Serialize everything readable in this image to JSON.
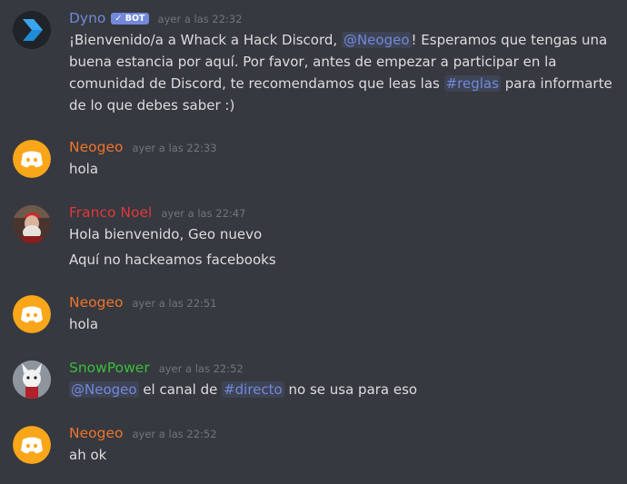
{
  "messages": [
    {
      "author": "Dyno",
      "author_color": "#7289da",
      "bot_tag": "BOT",
      "timestamp": "ayer a las 22:32",
      "avatar": "dyno-avatar",
      "segments": [
        {
          "type": "text",
          "text": "¡Bienvenido/a a Whack a Hack Discord, "
        },
        {
          "type": "mention",
          "text": "@Neogeo"
        },
        {
          "type": "text",
          "text": "! Esperamos que tengas una buena estancia por aquí. Por favor, antes de empezar a participar en la comunidad de Discord, te recomendamos que leas las "
        },
        {
          "type": "mention",
          "text": "#reglas"
        },
        {
          "type": "text",
          "text": " para informarte de lo que debes saber :)"
        }
      ]
    },
    {
      "author": "Neogeo",
      "author_color": "#f0742a",
      "timestamp": "ayer a las 22:33",
      "avatar": "discord-default-avatar",
      "lines": [
        "hola"
      ]
    },
    {
      "author": "Franco Noel",
      "author_color": "#e0383c",
      "timestamp": "ayer a las 22:47",
      "avatar": "user-photo-avatar",
      "lines": [
        "Hola bienvenido, Geo nuevo",
        "Aquí no hackeamos facebooks"
      ]
    },
    {
      "author": "Neogeo",
      "author_color": "#f0742a",
      "timestamp": "ayer a las 22:51",
      "avatar": "discord-default-avatar",
      "lines": [
        "hola"
      ]
    },
    {
      "author": "SnowPower",
      "author_color": "#3dbc3d",
      "timestamp": "ayer a las 22:52",
      "avatar": "user-photo-avatar",
      "segments": [
        {
          "type": "mention",
          "text": "@Neogeo"
        },
        {
          "type": "text",
          "text": " el canal de "
        },
        {
          "type": "mention",
          "text": "#directo"
        },
        {
          "type": "text",
          "text": " no se usa para eso"
        }
      ]
    },
    {
      "author": "Neogeo",
      "author_color": "#f0742a",
      "timestamp": "ayer a las 22:52",
      "avatar": "discord-default-avatar",
      "lines": [
        "ah ok"
      ]
    }
  ]
}
